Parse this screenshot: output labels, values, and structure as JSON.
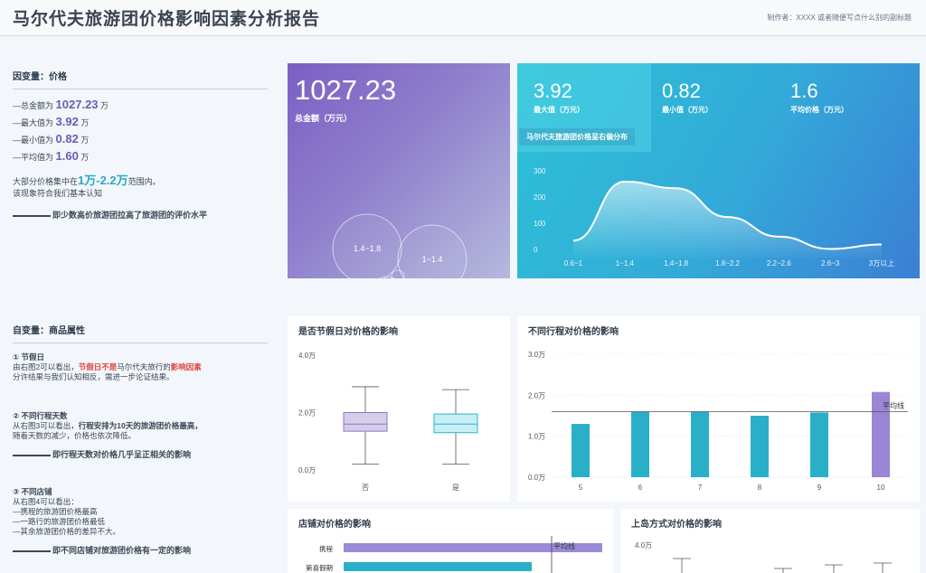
{
  "header": {
    "title": "马尔代夫旅游团价格影响因素分析报告",
    "subtitle": "制作者：XXXX 或者随便写点什么别的副标题"
  },
  "dependent": {
    "title": "因变量：价格",
    "stats": [
      {
        "prefix": "—总金额为",
        "value": "1027.23",
        "unit": "万"
      },
      {
        "prefix": "—最大值为",
        "value": "3.92",
        "unit": "万"
      },
      {
        "prefix": "—最小值为",
        "value": "0.82",
        "unit": "万"
      },
      {
        "prefix": "—平均值为",
        "value": "1.60",
        "unit": "万"
      }
    ],
    "note_prefix": "大部分价格集中在",
    "note_range": "1万-2.2万",
    "note_suffix": "范围内。",
    "note_line2": "该现象符合我们基本认知",
    "conclusion": "即少数高价旅游团拉高了旅游团的评价水平"
  },
  "independent": {
    "title": "自变量：商品属性",
    "factor1": {
      "title": "① 节假日",
      "line1_a": "由右图2可以看出，",
      "line1_red": "节假日不是",
      "line1_b": "马尔代夫旅行的",
      "line1_red2": "影响因素",
      "line2": "分许结果与我们认知相反，需进一步论证结果。"
    },
    "factor2": {
      "title": "② 不同行程天数",
      "line1_a": "从右图3可以看出，",
      "line1_b": "行程安排为10天的旅游团价格最高，",
      "line2": "随着天数的减少，价格也依次降低。",
      "conclusion": "即行程天数对价格几乎呈正相关的影响"
    },
    "factor3": {
      "title": "③ 不同店铺",
      "line1": "从右图4可以看出：",
      "line2": "—携程的旅游团价格最高",
      "line3": "—一路行的旅游团价格最低",
      "line4": "—其余旅游团价格的差异不大。",
      "conclusion": "即不同店铺对旅游团价格有一定的影响"
    }
  },
  "purple_card": {
    "total": "1027.23",
    "total_label": "总金额（万元）",
    "bubbles": [
      {
        "label": "1.4~1.8"
      },
      {
        "label": "1~1.4"
      },
      {
        "label": ""
      },
      {
        "label": ""
      },
      {
        "label": ""
      }
    ]
  },
  "blue_card": {
    "kpis": [
      {
        "value": "3.92",
        "label": "最大值（万元）"
      },
      {
        "value": "0.82",
        "label": "最小值（万元）"
      },
      {
        "value": "1.6",
        "label": "平均价格（万元）"
      }
    ],
    "dist_title": "马尔代夫旅游团价格呈右偏分布"
  },
  "chart_data": [
    {
      "type": "area",
      "title": "马尔代夫旅游团价格呈右偏分布",
      "categories": [
        "0.6~1",
        "1~1.4",
        "1.4~1.8",
        "1.8~2.2",
        "2.2~2.6",
        "2.6~3",
        "3万以上"
      ],
      "values": [
        20,
        245,
        220,
        110,
        35,
        -12,
        5
      ],
      "yticks": [
        "300",
        "200",
        "100",
        "0"
      ],
      "ylim": [
        0,
        300
      ]
    },
    {
      "type": "box",
      "title": "是否节假日对价格的影响",
      "categories": [
        "否",
        "是"
      ],
      "yticks": [
        "4.0万",
        "2.0万",
        "0.0万"
      ],
      "ylim": [
        0,
        4
      ],
      "boxes": [
        {
          "min": 0.2,
          "q1": 1.35,
          "median": 1.6,
          "q3": 2.0,
          "max": 2.9
        },
        {
          "min": 0.2,
          "q1": 1.3,
          "median": 1.6,
          "q3": 1.95,
          "max": 2.8
        }
      ]
    },
    {
      "type": "bar",
      "title": "不同行程对价格的影响",
      "categories": [
        "5",
        "6",
        "7",
        "8",
        "9",
        "10"
      ],
      "values": [
        1.3,
        1.6,
        1.6,
        1.5,
        1.58,
        2.08
      ],
      "yticks": [
        "3.0万",
        "2.0万",
        "1.0万",
        "0.0万"
      ],
      "ylim": [
        0,
        3
      ],
      "reference_line": {
        "label": "平均线",
        "value": 1.6
      }
    },
    {
      "type": "bar",
      "title": "店铺对价格的影响",
      "categories": [
        "携程",
        "第喜假期"
      ],
      "values": [
        2.2,
        1.6
      ],
      "reference_line": {
        "label": "平均线",
        "value": 1.6
      }
    },
    {
      "type": "box",
      "title": "上岛方式对价格的影响",
      "yticks": [
        "4.0万"
      ]
    }
  ],
  "colors": {
    "purple": "#9b8bd6",
    "teal": "#29b0c8",
    "highlight_bar": "#9a86d4",
    "accent_red": "#e0443d"
  }
}
